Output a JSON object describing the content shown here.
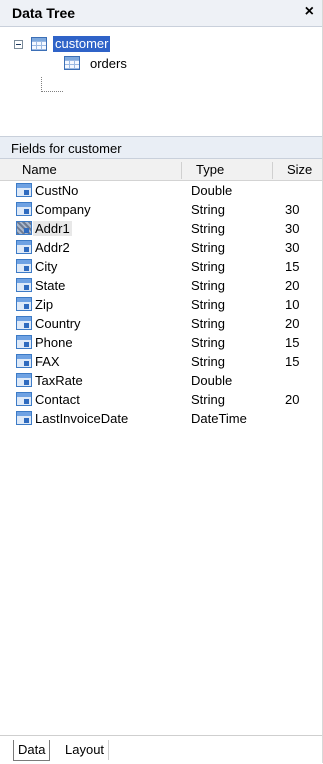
{
  "panel": {
    "title": "Data Tree",
    "close_glyph": "×"
  },
  "tree": {
    "nodes": [
      {
        "label": "customer",
        "selected": true,
        "icon": "table-icon"
      },
      {
        "label": "orders",
        "selected": false,
        "icon": "table-icon"
      }
    ]
  },
  "fields": {
    "header": "Fields for customer",
    "columns": [
      "Name",
      "Type",
      "Size"
    ],
    "rows": [
      {
        "name": "CustNo",
        "type": "Double",
        "size": ""
      },
      {
        "name": "Company",
        "type": "String",
        "size": "30"
      },
      {
        "name": "Addr1",
        "type": "String",
        "size": "30",
        "selected": true
      },
      {
        "name": "Addr2",
        "type": "String",
        "size": "30"
      },
      {
        "name": "City",
        "type": "String",
        "size": "15"
      },
      {
        "name": "State",
        "type": "String",
        "size": "20"
      },
      {
        "name": "Zip",
        "type": "String",
        "size": "10"
      },
      {
        "name": "Country",
        "type": "String",
        "size": "20"
      },
      {
        "name": "Phone",
        "type": "String",
        "size": "15"
      },
      {
        "name": "FAX",
        "type": "String",
        "size": "15"
      },
      {
        "name": "TaxRate",
        "type": "Double",
        "size": ""
      },
      {
        "name": "Contact",
        "type": "String",
        "size": "20"
      },
      {
        "name": "LastInvoiceDate",
        "type": "DateTime",
        "size": ""
      }
    ]
  },
  "tabs": [
    "Data",
    "Layout"
  ]
}
